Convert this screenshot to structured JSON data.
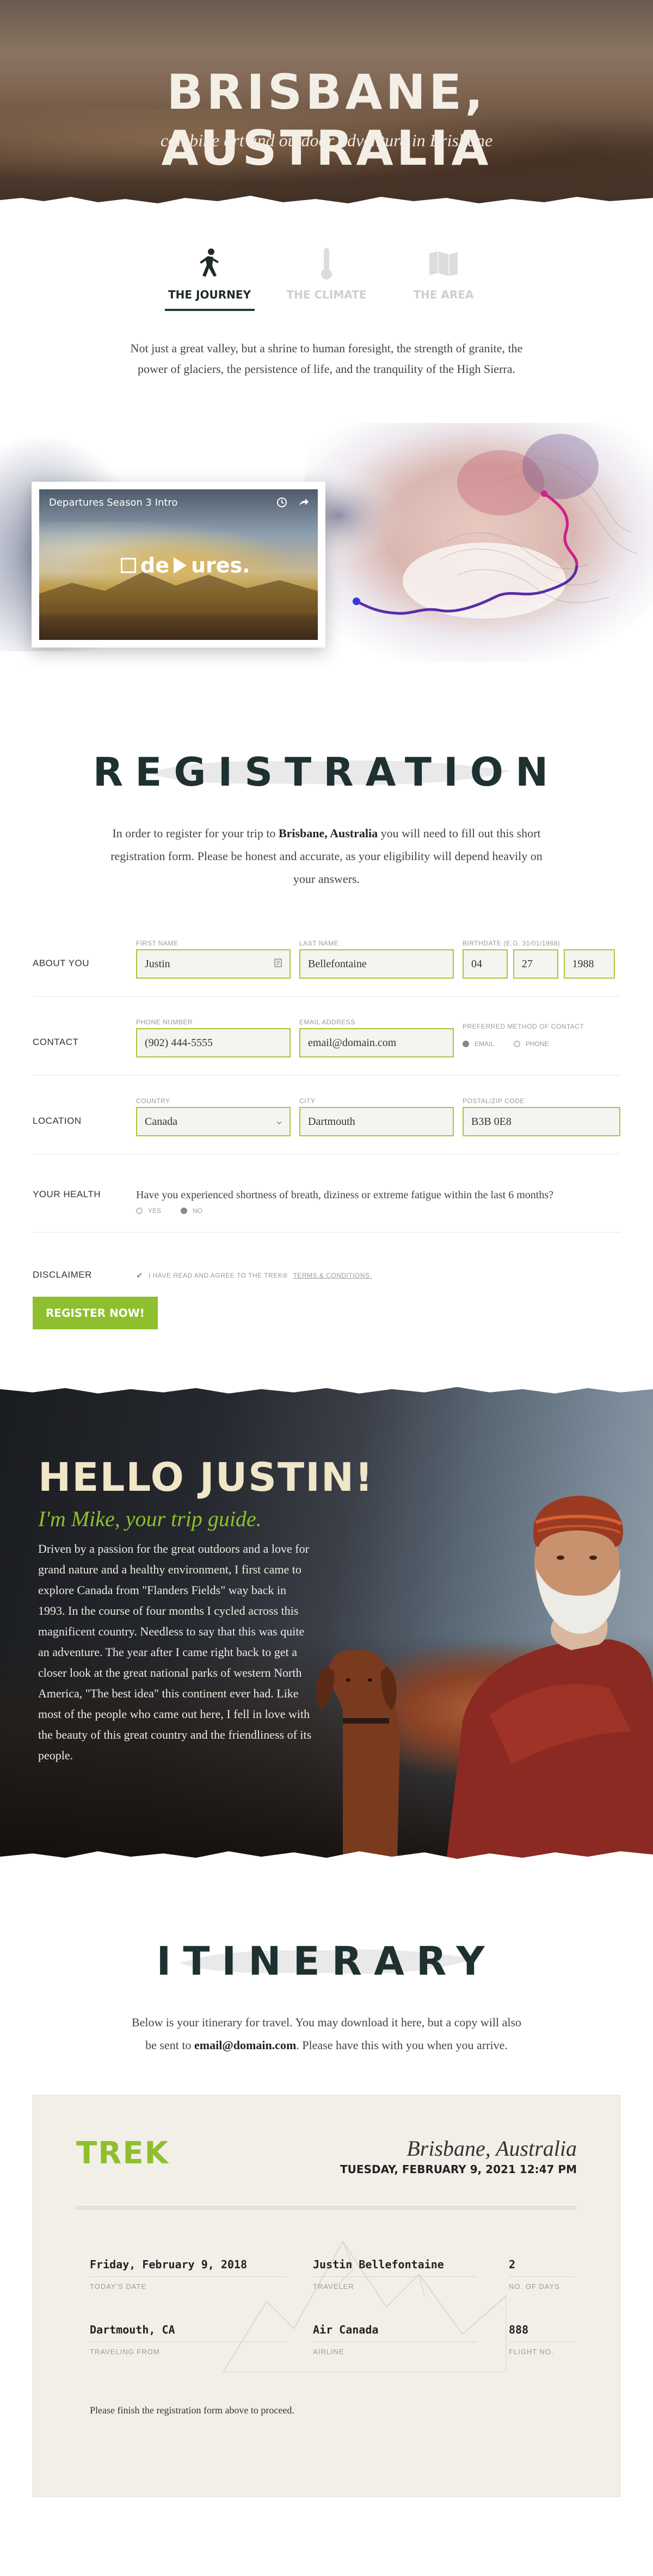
{
  "hero": {
    "title": "BRISBANE, AUSTRALIA",
    "subtitle": "combine art and outdoor adventure in Brisbane"
  },
  "tabs": [
    {
      "label": "THE JOURNEY",
      "icon": "hiker-icon",
      "active": true
    },
    {
      "label": "THE CLIMATE",
      "icon": "thermometer-icon",
      "active": false
    },
    {
      "label": "THE AREA",
      "icon": "map-icon",
      "active": false
    }
  ],
  "intro": "Not just a great valley, but a shrine to human foresight, the strength of granite, the power of glaciers, the persistence of life, and the tranquility of the High Sierra.",
  "video": {
    "title": "Departures Season 3 Intro",
    "brand_left": "de",
    "brand_right": "ures."
  },
  "registration": {
    "heading": "REGISTRATION",
    "intro_before": "In order to register for your trip to ",
    "intro_place": "Brisbane, Australia",
    "intro_after": " you will need to fill out this short registration form. Please be honest and accurate, as your eligibility will depend heavily on your answers.",
    "rows": {
      "about": {
        "label": "ABOUT YOU",
        "first_name_label": "FIRST NAME",
        "first_name": "Justin",
        "last_name_label": "LAST NAME",
        "last_name": "Bellefontaine",
        "birthdate_label": "BIRTHDATE (E.G. 31/01/1988)",
        "birth_day": "04",
        "birth_month": "27",
        "birth_year": "1988"
      },
      "contact": {
        "label": "CONTACT",
        "phone_label": "PHONE NUMBER",
        "phone": "(902) 444-5555",
        "email_label": "EMAIL ADDRESS",
        "email": "email@domain.com",
        "method_label": "PREFERRED METHOD OF CONTACT",
        "method_email": "EMAIL",
        "method_phone": "PHONE"
      },
      "location": {
        "label": "LOCATION",
        "country_label": "COUNTRY",
        "country": "Canada",
        "city_label": "CITY",
        "city": "Dartmouth",
        "postal_label": "POSTAL/ZIP CODE",
        "postal": "B3B 0E8"
      },
      "health": {
        "label": "YOUR HEALTH",
        "question": "Have you experienced shortness of breath, diziness or extreme fatigue within the last 6 months?",
        "yes": "YES",
        "no": "NO"
      },
      "disclaimer": {
        "label": "DISCLAIMER",
        "text": "I HAVE READ AND AGREE TO THE TREK® ",
        "terms": "TERMS & CONDITIONS."
      }
    },
    "button": "REGISTER NOW!"
  },
  "guide": {
    "hello": "HELLO JUSTIN!",
    "subtitle": "I'm Mike, your trip guide.",
    "text": "Driven by a passion for the great outdoors and a love for grand nature and a healthy environment, I first came to explore Canada from \"Flanders Fields\" way back in 1993. In the course of four months I cycled across this magnificent country. Needless to say that this was quite an adventure. The year after I came right back to get a closer look at the great national parks of western North America, \"The best idea\" this continent ever had. Like most of the people who came out here, I fell in love with the beauty of this great country and the friendliness of its people."
  },
  "itinerary": {
    "heading": "ITINERARY",
    "intro_before": "Below is your itinerary for travel. You may download it here, but a copy will also be sent to ",
    "intro_email": "email@domain.com",
    "intro_after": ". Please have this with you when you arrive.",
    "ticket": {
      "logo": "TREK",
      "destination": "Brisbane, Australia",
      "date": "TUESDAY, FEBRUARY 9, 2021 12:47 PM",
      "today_date": "Friday, February 9, 2018",
      "today_date_label": "TODAY'S DATE",
      "traveler": "Justin Bellefontaine",
      "traveler_label": "TRAVELER",
      "days": "2",
      "days_label": "NO. OF DAYS",
      "from": "Dartmouth, CA",
      "from_label": "TRAVELING FROM",
      "airline": "Air Canada",
      "airline_label": "AIRLINE",
      "flight": "888",
      "flight_label": "FLIGHT NO.",
      "note": "Please finish the registration form above to proceed."
    }
  },
  "colors": {
    "accent_green": "#8fbf2e",
    "heading_dark": "#1e3030",
    "route_purple": "#5a2ea8",
    "route_magenta": "#d0208a"
  }
}
